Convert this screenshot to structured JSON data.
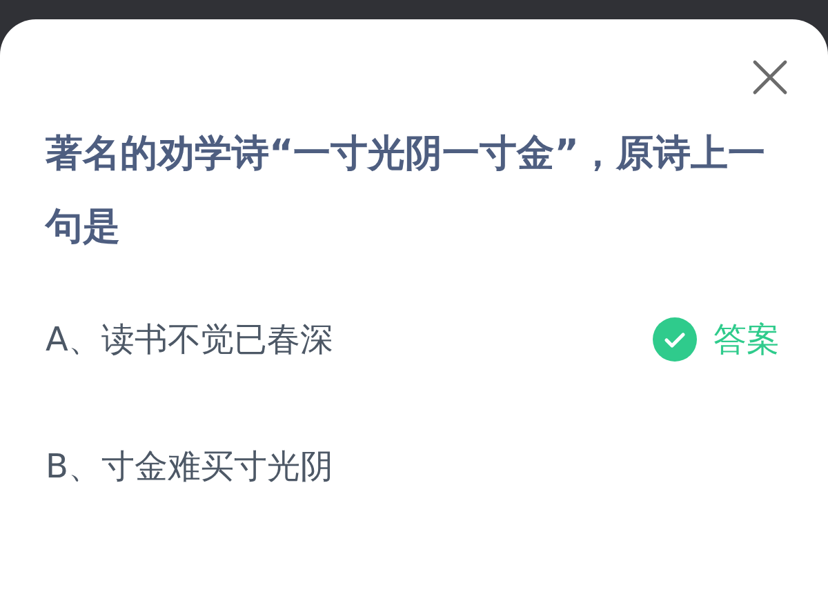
{
  "question": "著名的劝学诗“一寸光阴一寸金”，原诗上一句是",
  "options": [
    {
      "text": "A、读书不觉已春深",
      "correct": true,
      "answer_label": "答案"
    },
    {
      "text": "B、寸金难买寸光阴",
      "correct": false
    }
  ]
}
